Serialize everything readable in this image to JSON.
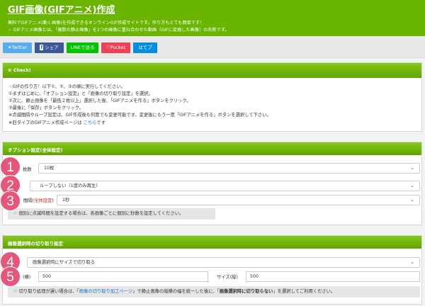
{
  "header": {
    "title": "GIF画像(GIFアニメ)作成",
    "line1": "無料でGIFアニメ(動く画像)を作成できるオンラインGIF作成サイトです。作り方もとても簡単です！",
    "line2": "GIFアニメ画像とは、「複数の静止画像」を1つの画像に重ね合わせた動画（GIFに変換した画像）の名称です。"
  },
  "share": {
    "twitter": "Twitter",
    "facebook": "シェア",
    "line": "LINEで送る",
    "pocket": "Pocket",
    "hatena": "はてブ"
  },
  "check": {
    "title": "Check!",
    "lines": [
      "GIFの作り方！以下①、②、③の順に実行してください。",
      "①まずはじめに、「オプション設定」と「画像の切り取り設定」を選択。",
      "②次に、静止画像を「最低２枚以上」選択した後、「GIFアニメを作る」ボタンをクリック。",
      "③最後に「保存」ボタンをクリック。",
      "※点滅間隔やループ設定は、GIF作成後も何度でも変更可能です。変更後にもう一度「GIFアニメを作る」ボタンを選択して下さい。"
    ],
    "old_prefix": "※旧タイプのGIFアニメ作成ページは",
    "old_link": "こちら",
    "old_suffix": "です"
  },
  "options": {
    "title": "オプション設定(全体設定)",
    "count_label": "枚数",
    "count_value": "10枚",
    "loop_value": "ループしない（1度のみ再生）",
    "interval_label_a": "間隔(",
    "interval_label_b": "全体設定",
    "interval_label_c": ")",
    "interval_value": "1秒",
    "note": "個別に点滅時間を設定する場合は、各画像ごとに個別に秒数を設定してください。"
  },
  "crop": {
    "title": "画像選択時の切り取り設定",
    "mode_value": "画像選択時にサイズで切り取る",
    "width_label": "(横)",
    "width_value": "500",
    "height_label": "サイズ(縦)",
    "height_value": "500",
    "note_a": "切り取り処理が遅い場合は、「",
    "note_link": "画像の切り取り加工ページ",
    "note_b": "」で静止画像の縦横の幅を統一した後に、「",
    "note_bold": "画像選択時に切り取らない",
    "note_c": "」を選択してご利用ください。"
  },
  "badges": [
    "1",
    "2",
    "3",
    "4",
    "5"
  ],
  "colors": {
    "header": "#6ab500",
    "twitter": "#55acee",
    "facebook": "#3b5998",
    "line": "#00c300",
    "pocket": "#ee4056",
    "hatena": "#008fde",
    "badge": "#e6567a"
  }
}
